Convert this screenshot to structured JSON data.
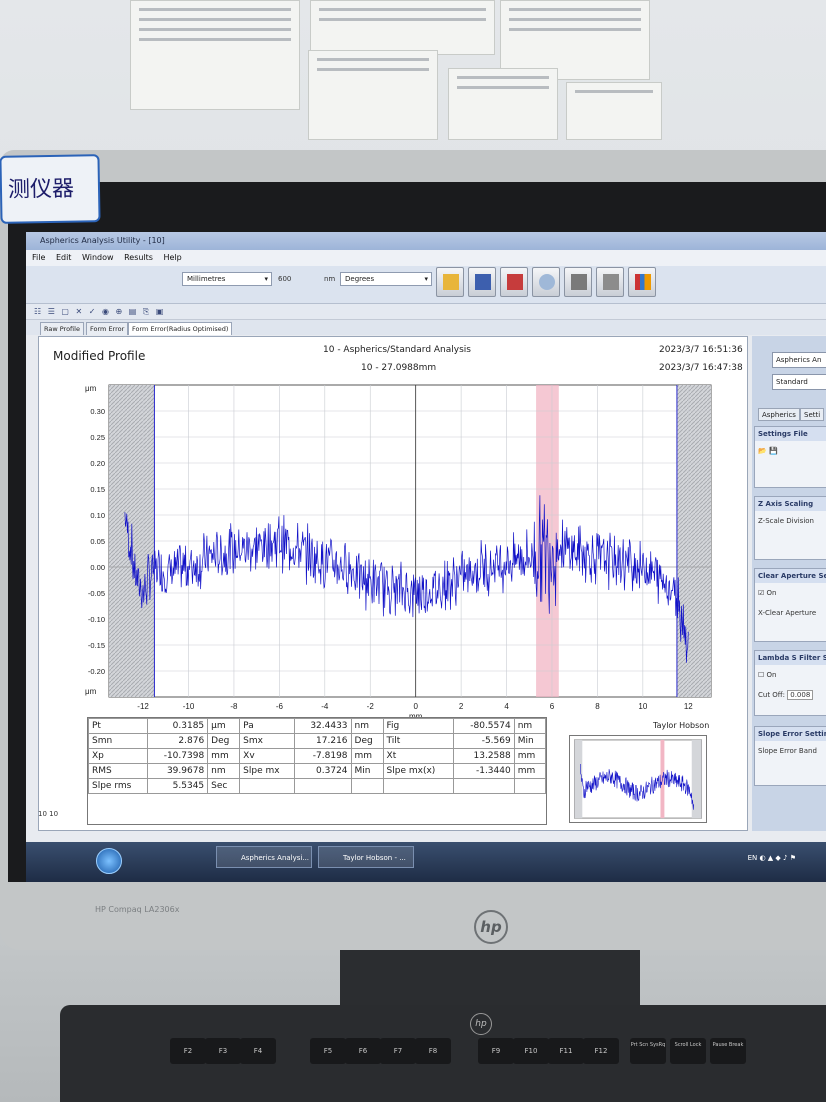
{
  "window": {
    "title": "Aspherics Analysis Utility - [10]"
  },
  "menu": [
    "File",
    "Edit",
    "Window",
    "Results",
    "Help"
  ],
  "toolbar": {
    "units": "Millimetres",
    "wavelength": "600",
    "wavelength_unit": "nm",
    "angle_units": "Degrees"
  },
  "tabs": [
    "Raw Profile",
    "Form Error",
    "Form Error(Radius Optimised)"
  ],
  "panel": {
    "title": "Modified Profile",
    "analysis": "10 - Aspherics/Standard Analysis",
    "range": "10 - 27.0988mm",
    "date1": "2023/3/7  16:51:36",
    "date2": "2023/3/7  16:47:38",
    "credit": "Taylor Hobson"
  },
  "chart_data": {
    "type": "line",
    "ylabel": "μm",
    "xlabel": "mm",
    "xlim": [
      -13.5,
      13
    ],
    "ylim": [
      -0.25,
      0.35
    ],
    "x_ticks": [
      -12,
      -10,
      -8,
      -6,
      -4,
      -2,
      0,
      2,
      4,
      6,
      8,
      10,
      12
    ],
    "y_ticks": [
      0.3,
      0.25,
      0.2,
      0.15,
      0.1,
      0.05,
      0.0,
      -0.05,
      -0.1,
      -0.15,
      -0.2
    ],
    "y_tick_labels": [
      "0.30",
      "0.25",
      "0.20",
      "0.15",
      "0.10",
      "0.05",
      "0.00",
      "-0.05",
      "-0.10",
      "-0.15",
      "-0.20"
    ],
    "y_bottom_label": "μm",
    "excluded_left": [
      -13.5,
      -11.5
    ],
    "excluded_right": [
      11.5,
      13
    ],
    "highlight_band": [
      5.3,
      6.3
    ],
    "series": [
      {
        "color": "#1212c8",
        "x": [
          -12.8,
          -12.3,
          -12.0,
          -11.5,
          -11.0,
          -10.0,
          -9.0,
          -8.0,
          -7.0,
          -6.0,
          -5.0,
          -4.0,
          -3.0,
          -2.0,
          -1.0,
          0.0,
          1.0,
          2.0,
          3.0,
          4.0,
          5.0,
          5.6,
          6.0,
          7.0,
          8.0,
          9.0,
          10.0,
          11.0,
          11.5,
          12.0
        ],
        "y": [
          0.1,
          -0.02,
          -0.05,
          0.0,
          -0.01,
          0.0,
          0.02,
          0.03,
          0.04,
          0.05,
          0.03,
          0.01,
          0.0,
          -0.03,
          -0.04,
          -0.05,
          -0.04,
          -0.02,
          0.0,
          0.01,
          0.02,
          0.03,
          0.04,
          0.03,
          0.02,
          0.01,
          0.0,
          -0.03,
          -0.05,
          -0.15
        ],
        "noise": 0.055
      }
    ]
  },
  "stats": [
    [
      "Pt",
      "0.3185",
      "μm",
      "Pa",
      "32.4433",
      "nm",
      "Fig",
      "-80.5574",
      "nm"
    ],
    [
      "Smn",
      "2.876",
      "Deg",
      "Smx",
      "17.216",
      "Deg",
      "Tilt",
      "-5.569",
      "Min"
    ],
    [
      "Xp",
      "-10.7398",
      "mm",
      "Xv",
      "-7.8198",
      "mm",
      "Xt",
      "13.2588",
      "mm"
    ],
    [
      "RMS",
      "39.9678",
      "nm",
      "Slpe mx",
      "0.3724",
      "Min",
      "Slpe mx(x)",
      "-1.3440",
      "mm"
    ],
    [
      "Slpe rms",
      "5.5345",
      "Sec",
      "",
      "",
      "",
      "",
      "",
      ""
    ]
  ],
  "side": {
    "combo1": "Aspherics An",
    "combo2": "Standard",
    "tab1": "Aspherics",
    "tab2": "Setti",
    "settings_file": "Settings File",
    "z_axis": "Z Axis Scaling",
    "z_scale": "Z-Scale Division",
    "clear_aperture": "Clear Aperture Se",
    "on": "On",
    "x_clear": "X-Clear Aperture",
    "lambda": "Lambda S Filter Set",
    "lambda_on": "On",
    "cutoff": "Cut Off:",
    "cutoff_val": "0.008",
    "slope_error": "Slope Error Settings",
    "slope_band": "Slope Error Band"
  },
  "bottom_tabs": "10  10",
  "taskbar": {
    "task1": "Aspherics Analysi...",
    "task2": "Taylor Hobson - ...",
    "lang": "EN"
  },
  "monitor": {
    "label": "测仪器",
    "brand": "HP Compaq LA2306x",
    "logo": "hp"
  },
  "keys": [
    "F2",
    "F3",
    "F4",
    "F5",
    "F6",
    "F7",
    "F8",
    "F9",
    "F10",
    "F11",
    "F12",
    "Prt Scn SysRq",
    "Scroll Lock",
    "Pause Break"
  ]
}
